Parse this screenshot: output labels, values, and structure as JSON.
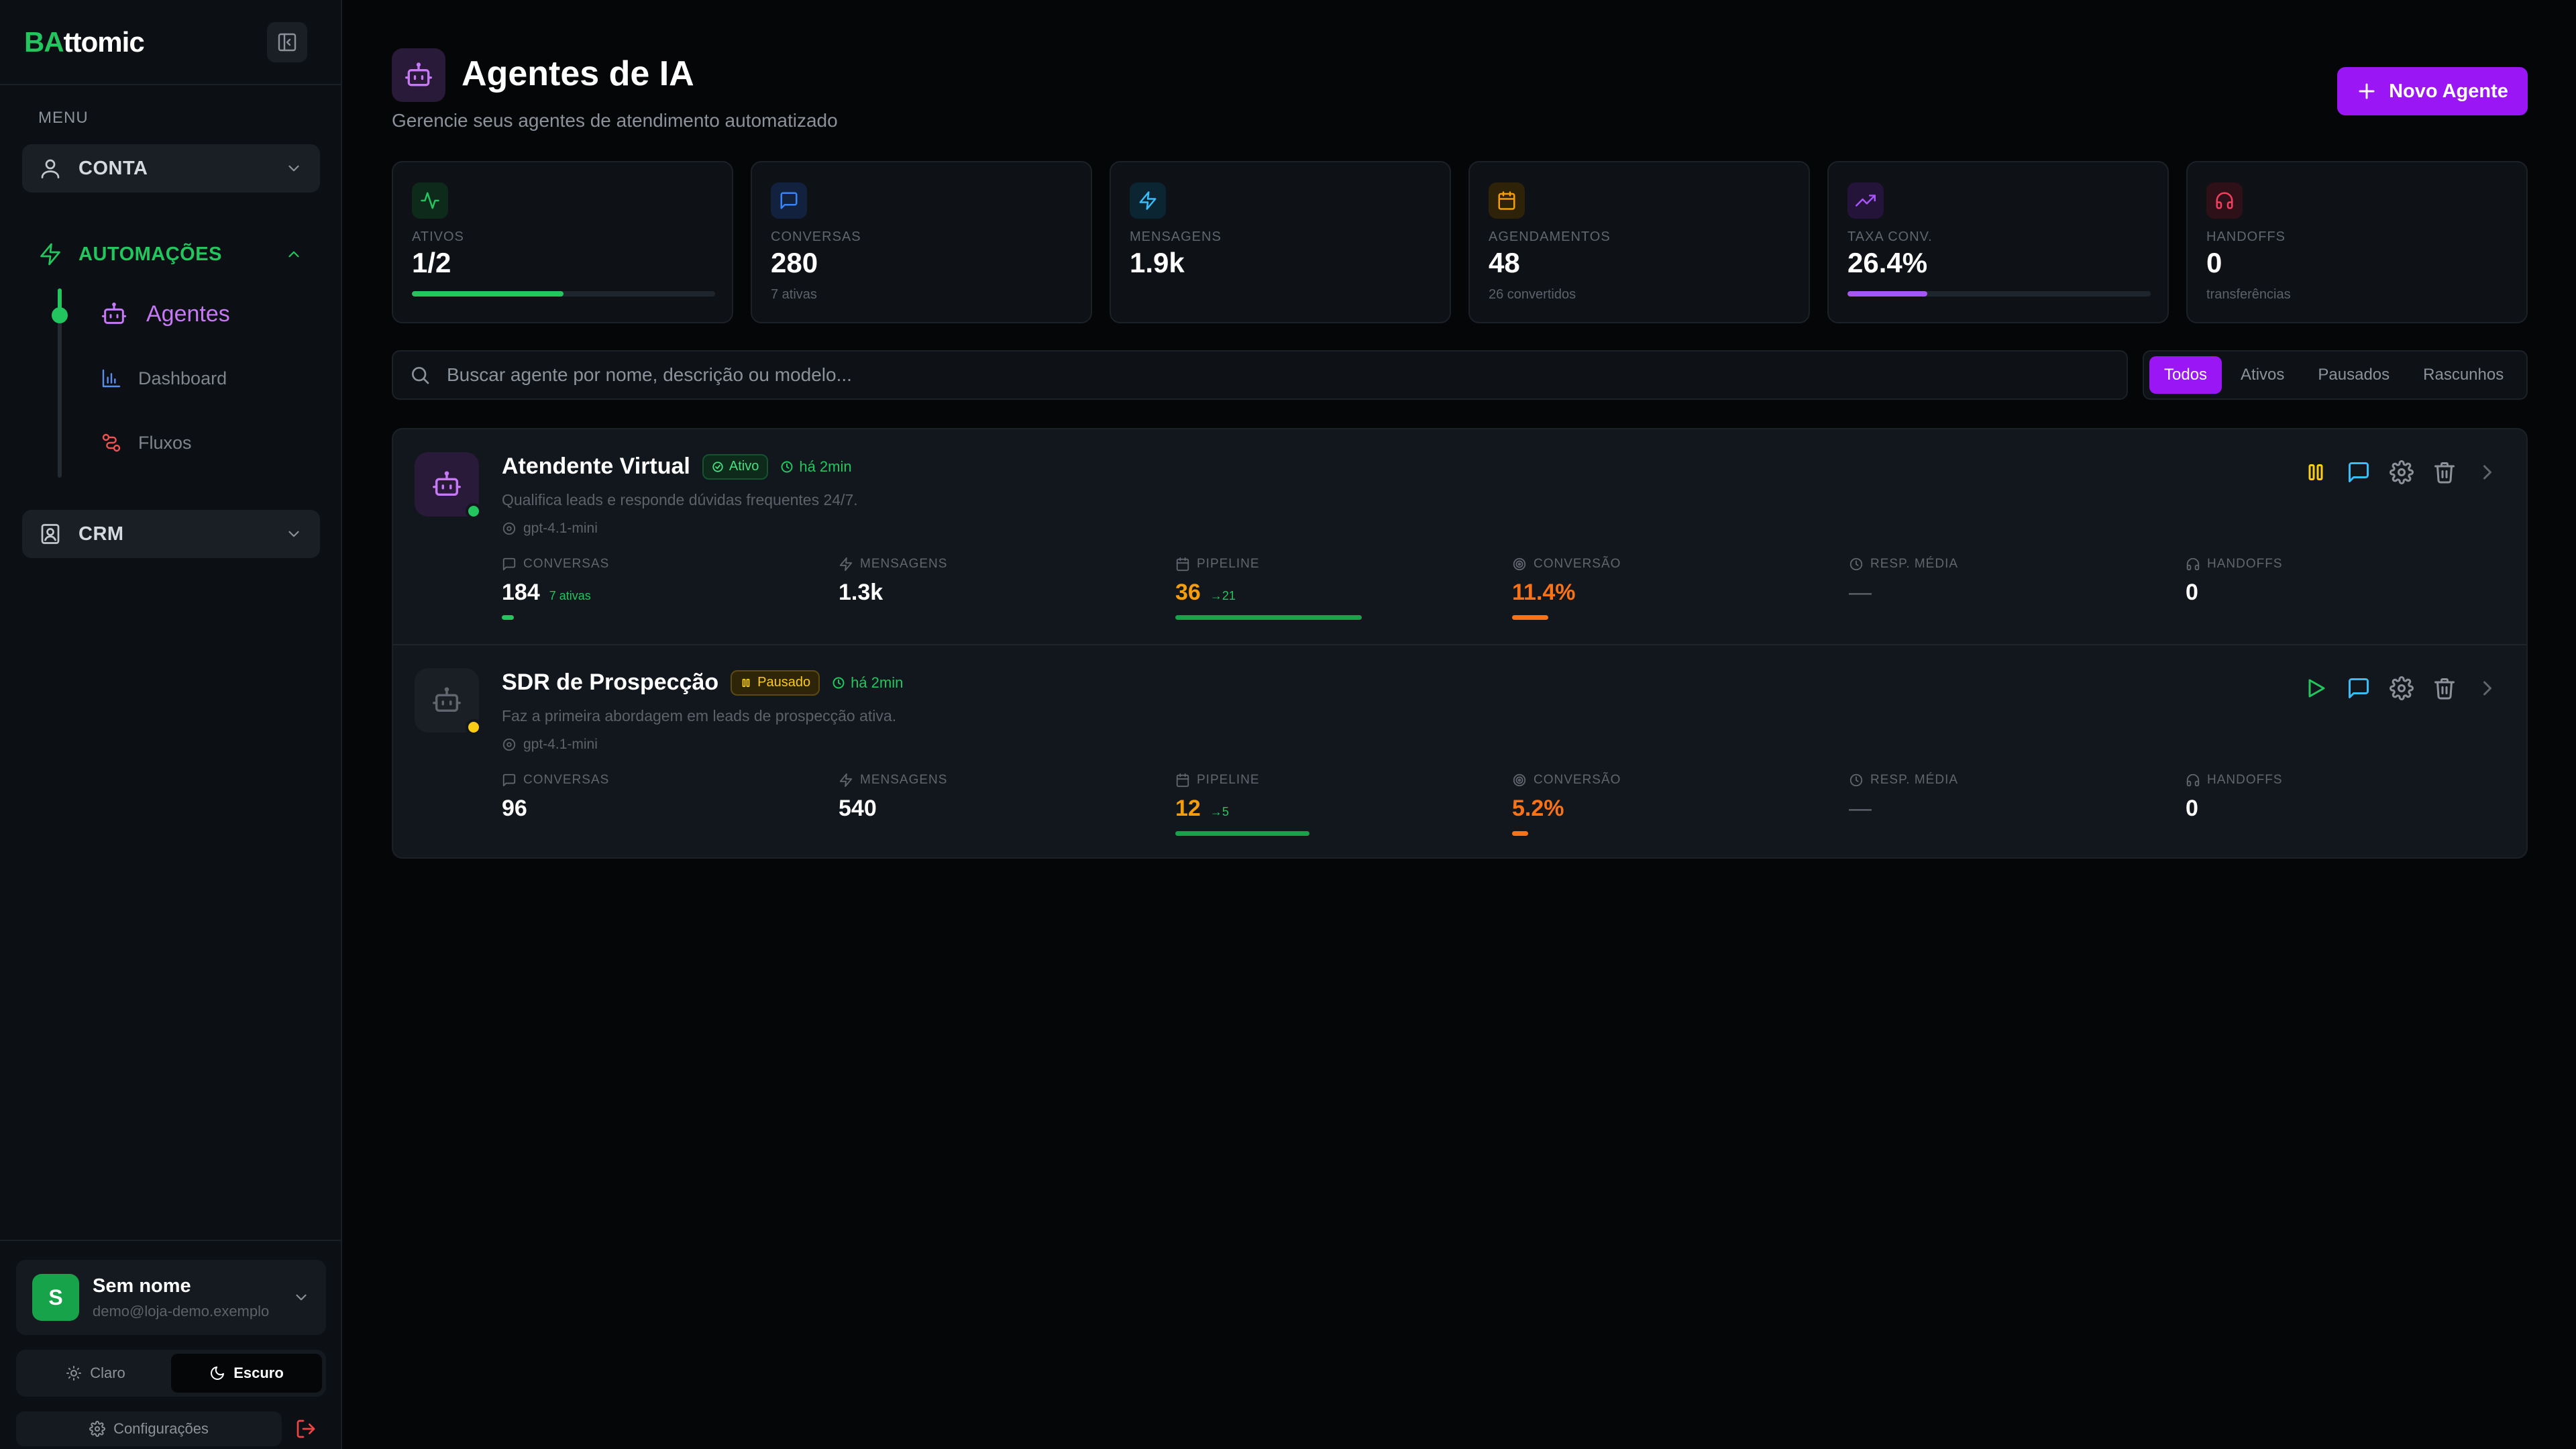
{
  "brand": {
    "prefix": "BA",
    "rest": "ttomic"
  },
  "sidebar": {
    "menu_label": "MENU",
    "groups": [
      {
        "label": "CONTA",
        "icon": "user-icon"
      },
      {
        "label": "AUTOMAÇÕES",
        "icon": "zap-icon",
        "expanded": true
      },
      {
        "label": "CRM",
        "icon": "contact-icon"
      }
    ],
    "sub_items": [
      {
        "label": "Agentes",
        "icon": "bot-icon",
        "active": true
      },
      {
        "label": "Dashboard",
        "icon": "bar-chart-icon"
      },
      {
        "label": "Fluxos",
        "icon": "workflow-icon"
      }
    ],
    "user": {
      "initial": "S",
      "name": "Sem nome",
      "email": "demo@loja-demo.exemplo"
    },
    "theme": {
      "light": "Claro",
      "dark": "Escuro",
      "selected": "dark"
    },
    "settings_label": "Configurações"
  },
  "header": {
    "title": "Agentes de IA",
    "subtitle": "Gerencie seus agentes de atendimento automatizado",
    "new_button": "Novo Agente"
  },
  "stats": [
    {
      "label": "ATIVOS",
      "value": "1/2",
      "progress": 0.5,
      "color": "#22c55e",
      "icon": "activity-icon"
    },
    {
      "label": "CONVERSAS",
      "value": "280",
      "sub": "7 ativas",
      "color": "#3b82f6",
      "icon": "message-icon"
    },
    {
      "label": "MENSAGENS",
      "value": "1.9k",
      "color": "#38bdf8",
      "icon": "zap-icon"
    },
    {
      "label": "AGENDAMENTOS",
      "value": "48",
      "sub": "26 convertidos",
      "color": "#f59e0b",
      "icon": "calendar-icon"
    },
    {
      "label": "TAXA CONV.",
      "value": "26.4%",
      "progress": 0.264,
      "color": "#a855f7",
      "icon": "trending-up-icon"
    },
    {
      "label": "HANDOFFS",
      "value": "0",
      "sub": "transferências",
      "color": "#f43f5e",
      "icon": "headphones-icon"
    }
  ],
  "search": {
    "placeholder": "Buscar agente por nome, descrição ou modelo..."
  },
  "filters": {
    "options": [
      "Todos",
      "Ativos",
      "Pausados",
      "Rascunhos"
    ],
    "selected": "Todos"
  },
  "metric_labels": [
    "CONVERSAS",
    "MENSAGENS",
    "PIPELINE",
    "CONVERSÃO",
    "RESP. MÉDIA",
    "HANDOFFS"
  ],
  "agents": [
    {
      "name": "Atendente Virtual",
      "status": "Ativo",
      "updated": "há 2min",
      "description": "Qualifica leads e responde dúvidas frequentes 24/7.",
      "model": "gpt-4.1-mini",
      "metrics": {
        "conversas": {
          "value": "184",
          "extra": "7 ativas"
        },
        "mensagens": {
          "value": "1.3k"
        },
        "pipeline": {
          "value": "36",
          "extra": "→21"
        },
        "conversao": {
          "value": "11.4%"
        },
        "resp_media": {
          "value": "—"
        },
        "handoffs": {
          "value": "0"
        }
      }
    },
    {
      "name": "SDR de Prospecção",
      "status": "Pausado",
      "updated": "há 2min",
      "description": "Faz a primeira abordagem em leads de prospecção ativa.",
      "model": "gpt-4.1-mini",
      "metrics": {
        "conversas": {
          "value": "96"
        },
        "mensagens": {
          "value": "540"
        },
        "pipeline": {
          "value": "12",
          "extra": "→5"
        },
        "conversao": {
          "value": "5.2%"
        },
        "resp_media": {
          "value": "—"
        },
        "handoffs": {
          "value": "0"
        }
      }
    }
  ]
}
